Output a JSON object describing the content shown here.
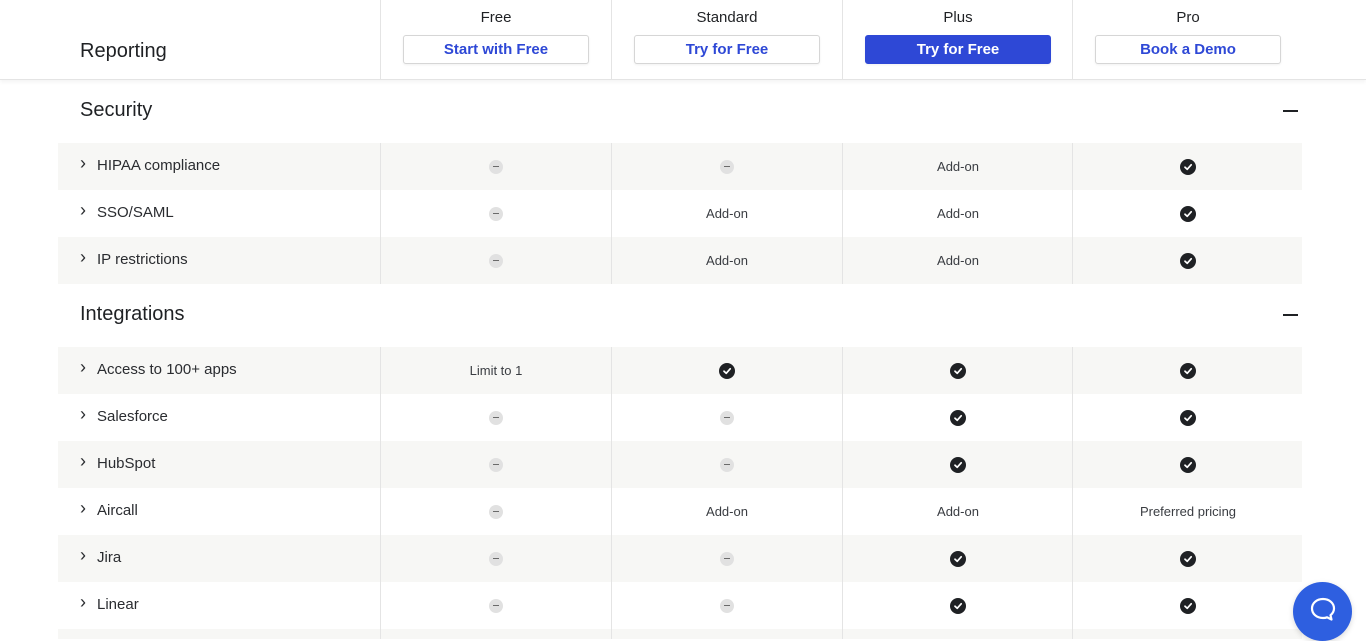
{
  "header": {
    "section_label": "Reporting",
    "plans": [
      {
        "name": "Free",
        "cta": "Start with Free",
        "primary": false
      },
      {
        "name": "Standard",
        "cta": "Try for Free",
        "primary": false
      },
      {
        "name": "Plus",
        "cta": "Try for Free",
        "primary": true
      },
      {
        "name": "Pro",
        "cta": "Book a Demo",
        "primary": false
      }
    ]
  },
  "sections": [
    {
      "title": "Security",
      "rows": [
        {
          "label": "HIPAA compliance",
          "values": [
            "dash",
            "dash",
            "Add-on",
            "check"
          ]
        },
        {
          "label": "SSO/SAML",
          "values": [
            "dash",
            "Add-on",
            "Add-on",
            "check"
          ]
        },
        {
          "label": "IP restrictions",
          "values": [
            "dash",
            "Add-on",
            "Add-on",
            "check"
          ]
        }
      ]
    },
    {
      "title": "Integrations",
      "rows": [
        {
          "label": "Access to 100+ apps",
          "values": [
            "Limit to 1",
            "check",
            "check",
            "check"
          ]
        },
        {
          "label": "Salesforce",
          "values": [
            "dash",
            "dash",
            "check",
            "check"
          ]
        },
        {
          "label": "HubSpot",
          "values": [
            "dash",
            "dash",
            "check",
            "check"
          ]
        },
        {
          "label": "Aircall",
          "values": [
            "dash",
            "Add-on",
            "Add-on",
            "Preferred pricing"
          ]
        },
        {
          "label": "Jira",
          "values": [
            "dash",
            "dash",
            "check",
            "check"
          ]
        },
        {
          "label": "Linear",
          "values": [
            "dash",
            "dash",
            "check",
            "check"
          ]
        }
      ]
    }
  ],
  "colors": {
    "accent": "#2e48d6",
    "chat": "#2e5fe0"
  },
  "icons": {
    "expand": "chevron-right-icon",
    "collapse": "minus-icon",
    "included": "check-circle-icon",
    "not_included": "dash-circle-icon",
    "chat": "chat-icon"
  }
}
